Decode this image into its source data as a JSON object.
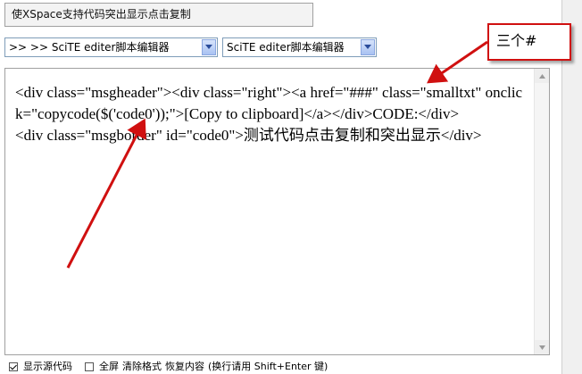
{
  "title_field": {
    "value": "使XSpace支持代码突出显示点击复制"
  },
  "selects": {
    "first": {
      "value": ">>   >> SciTE editer脚本编辑器"
    },
    "second": {
      "value": "SciTE editer脚本编辑器"
    }
  },
  "editor": {
    "lines": [
      "<div class=\"msgheader\"><div class=\"right\"><a href=\"###\" class=\"smalltxt\" onclick=\"copycode($('code0'));\">[Copy to clipboard]</a></div>CODE:</div>",
      "<div class=\"msgborder\" id=\"code0\">测试代码点击复制和突出显示</div>"
    ]
  },
  "callout": {
    "text": "三个#"
  },
  "bottom_bar": {
    "show_source_label": "显示源代码",
    "show_source_checked": true,
    "fullscreen_label": "全屏",
    "fullscreen_checked": false,
    "clear_format": "清除格式",
    "restore_content": "恢复内容",
    "hint": "(换行请用  Shift+Enter 键)"
  },
  "colors": {
    "annotation": "#d01010",
    "border": "#a0a0a0",
    "select_border": "#7f9db9"
  },
  "icons": [
    "chevron-down-icon",
    "scroll-up-icon",
    "scroll-down-icon",
    "checkbox-icon",
    "annotation-arrow-icon"
  ]
}
